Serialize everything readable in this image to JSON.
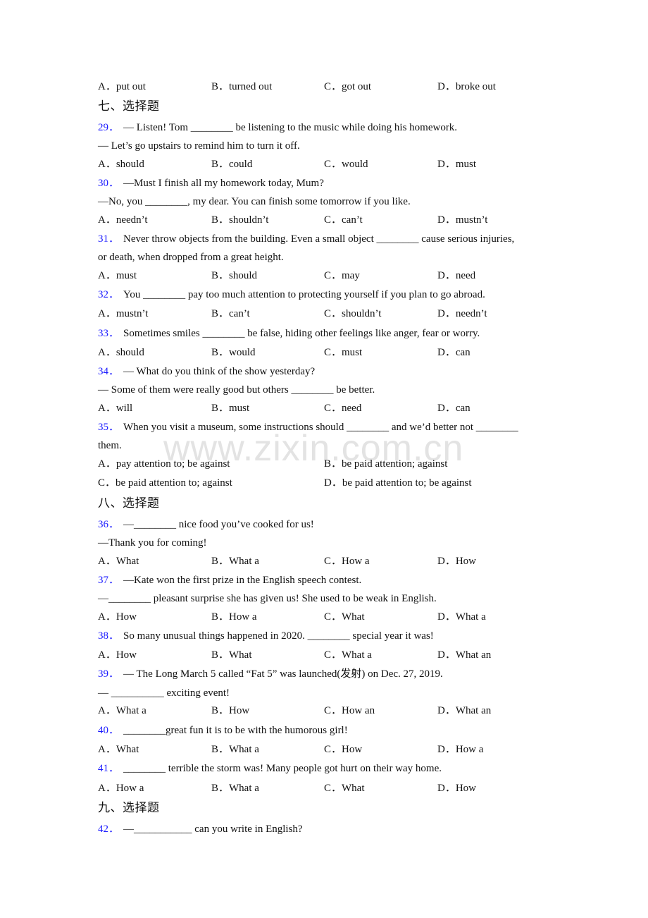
{
  "watermark": "www.zixin.com.cn",
  "top_options": [
    "A．put out",
    "B．turned out",
    "C．got out",
    "D．broke out"
  ],
  "sections": [
    {
      "heading": "七、选择题"
    },
    {
      "heading": "八、选择题"
    },
    {
      "heading": "九、选择题"
    }
  ],
  "questions": {
    "q29": {
      "num": "29．",
      "lines": [
        "— Listen! Tom ________ be listening to the music while doing his homework.",
        "— Let’s go upstairs to remind him to turn it off."
      ],
      "options": [
        "A．should",
        "B．could",
        "C．would",
        "D．must"
      ]
    },
    "q30": {
      "num": "30．",
      "lines": [
        "—Must I finish all my homework today, Mum?",
        "—No, you ________, my dear. You can finish some tomorrow if you like."
      ],
      "options": [
        "A．needn’t",
        "B．shouldn’t",
        "C．can’t",
        "D．mustn’t"
      ]
    },
    "q31": {
      "num": "31．",
      "lines": [
        "Never throw objects from the building. Even a small object ________ cause serious injuries,",
        "or death, when dropped from a great height."
      ],
      "options": [
        "A．must",
        "B．should",
        "C．may",
        "D．need"
      ]
    },
    "q32": {
      "num": "32．",
      "lines": [
        "You ________ pay too much attention to protecting yourself if you plan to go abroad."
      ],
      "options": [
        "A．mustn’t",
        "B．can’t",
        "C．shouldn’t",
        "D．needn’t"
      ]
    },
    "q33": {
      "num": "33．",
      "lines": [
        "Sometimes smiles ________ be false, hiding other feelings like anger, fear or worry."
      ],
      "options": [
        "A．should",
        "B．would",
        "C．must",
        "D．can"
      ]
    },
    "q34": {
      "num": "34．",
      "lines": [
        "— What do you think of the show yesterday?",
        "— Some of them were really good but others ________ be better."
      ],
      "options": [
        "A．will",
        "B．must",
        "C．need",
        "D．can"
      ]
    },
    "q35": {
      "num": "35．",
      "lines": [
        "When you visit a museum, some instructions should ________ and we’d better not ________",
        "them."
      ],
      "options": [
        "A．pay attention to; be against",
        "B．be paid attention; against",
        "C．be paid attention to; against",
        "D．be paid attention to; be against"
      ]
    },
    "q36": {
      "num": "36．",
      "lines": [
        "—________ nice food you’ve cooked for us!",
        "—Thank you for coming!"
      ],
      "options": [
        "A．What",
        "B．What a",
        "C．How a",
        "D．How"
      ]
    },
    "q37": {
      "num": "37．",
      "lines": [
        "—Kate won the first prize in the English speech contest.",
        "—________ pleasant surprise she has given us! She used to be weak in English."
      ],
      "options": [
        "A．How",
        "B．How a",
        "C．What",
        "D．What a"
      ]
    },
    "q38": {
      "num": "38．",
      "lines": [
        "So many unusual things happened in 2020. ________ special year it was!"
      ],
      "options": [
        "A．How",
        "B．What",
        "C．What a",
        "D．What an"
      ]
    },
    "q39": {
      "num": "39．",
      "lines": [
        "— The Long March 5 called “Fat 5” was launched(发射) on Dec. 27, 2019.",
        "— __________ exciting event!"
      ],
      "options": [
        "A．What a",
        "B．How",
        "C．How an",
        "D．What an"
      ]
    },
    "q40": {
      "num": "40．",
      "lines": [
        "________great fun it is to be with the humorous girl!"
      ],
      "options": [
        "A．What",
        "B．What a",
        "C．How",
        "D．How a"
      ]
    },
    "q41": {
      "num": "41．",
      "lines": [
        "________ terrible the storm was! Many people got hurt on their way home."
      ],
      "options": [
        "A．How a",
        "B．What a",
        "C．What",
        "D．How"
      ]
    },
    "q42": {
      "num": "42．",
      "lines": [
        "—___________ can you write in English?"
      ]
    }
  }
}
